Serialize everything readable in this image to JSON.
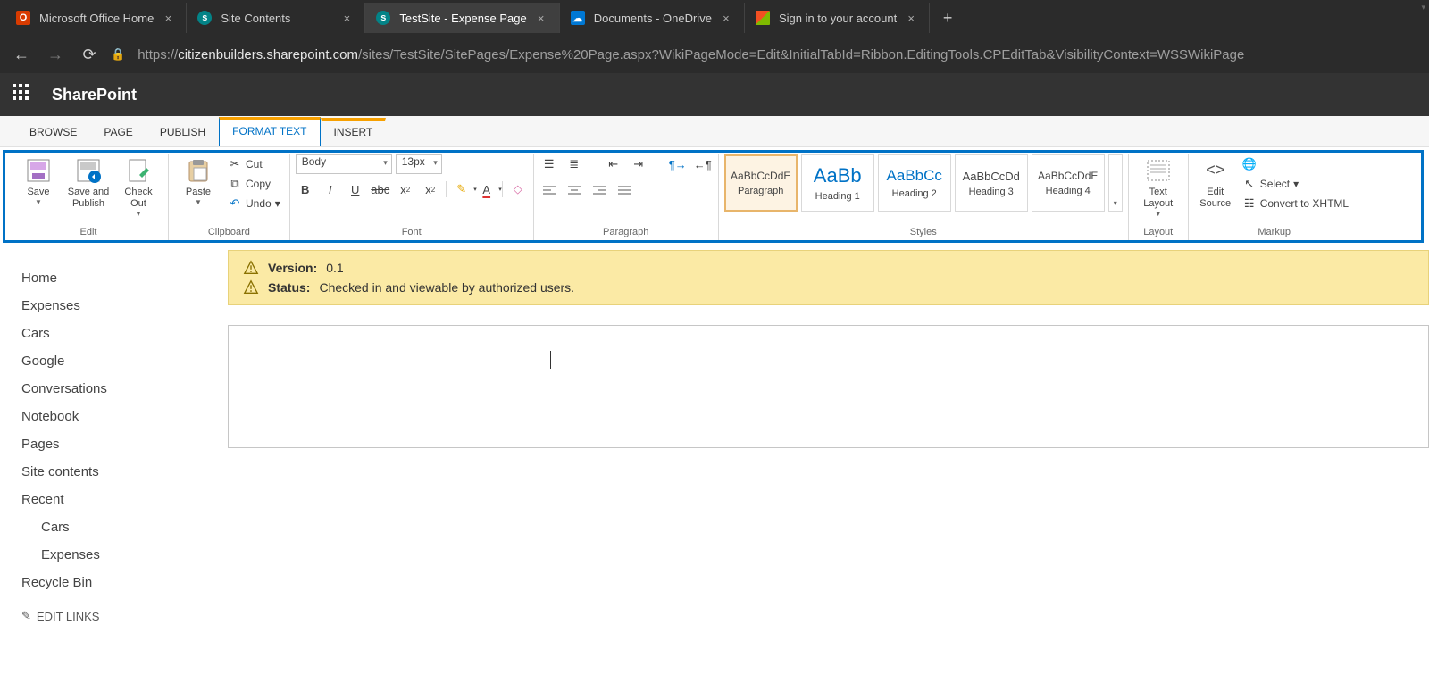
{
  "browser": {
    "tabs": [
      {
        "title": "Microsoft Office Home",
        "icon": "office"
      },
      {
        "title": "Site Contents",
        "icon": "sp"
      },
      {
        "title": "TestSite - Expense Page",
        "icon": "sp",
        "active": true
      },
      {
        "title": "Documents - OneDrive",
        "icon": "od"
      },
      {
        "title": "Sign in to your account",
        "icon": "ms"
      }
    ],
    "url_prefix": "https://",
    "url_host": "citizenbuilders.sharepoint.com",
    "url_path": "/sites/TestSite/SitePages/Expense%20Page.aspx?WikiPageMode=Edit&InitialTabId=Ribbon.EditingTools.CPEditTab&VisibilityContext=WSSWikiPage"
  },
  "suite": {
    "title": "SharePoint"
  },
  "ribbon_tabs": {
    "browse": "BROWSE",
    "page": "PAGE",
    "publish": "PUBLISH",
    "format_text": "FORMAT TEXT",
    "insert": "INSERT"
  },
  "ribbon": {
    "edit": {
      "label": "Edit",
      "save": "Save",
      "save_publish": "Save and Publish",
      "check_out": "Check Out"
    },
    "clipboard": {
      "label": "Clipboard",
      "paste": "Paste",
      "cut": "Cut",
      "copy": "Copy",
      "undo": "Undo"
    },
    "font": {
      "label": "Font",
      "name": "Body",
      "size": "13px"
    },
    "paragraph": {
      "label": "Paragraph"
    },
    "styles": {
      "label": "Styles",
      "items": [
        {
          "sample": "AaBbCcDdE",
          "name": "Paragraph",
          "selected": true
        },
        {
          "sample": "AaBb",
          "name": "Heading 1",
          "big": true
        },
        {
          "sample": "AaBbCc",
          "name": "Heading 2"
        },
        {
          "sample": "AaBbCcDd",
          "name": "Heading 3"
        },
        {
          "sample": "AaBbCcDdE",
          "name": "Heading 4"
        }
      ]
    },
    "layout": {
      "label": "Layout",
      "text_layout": "Text Layout"
    },
    "markup": {
      "label": "Markup",
      "edit_source": "Edit Source",
      "select": "Select",
      "convert": "Convert to XHTML"
    }
  },
  "leftnav": {
    "items": [
      "Home",
      "Expenses",
      "Cars",
      "Google",
      "Conversations",
      "Notebook",
      "Pages",
      "Site contents",
      "Recent"
    ],
    "recent_children": [
      "Cars",
      "Expenses"
    ],
    "recycle": "Recycle Bin",
    "edit_links": "EDIT LINKS"
  },
  "status": {
    "version_label": "Version:",
    "version_value": "0.1",
    "status_label": "Status:",
    "status_value": "Checked in and viewable by authorized users."
  }
}
